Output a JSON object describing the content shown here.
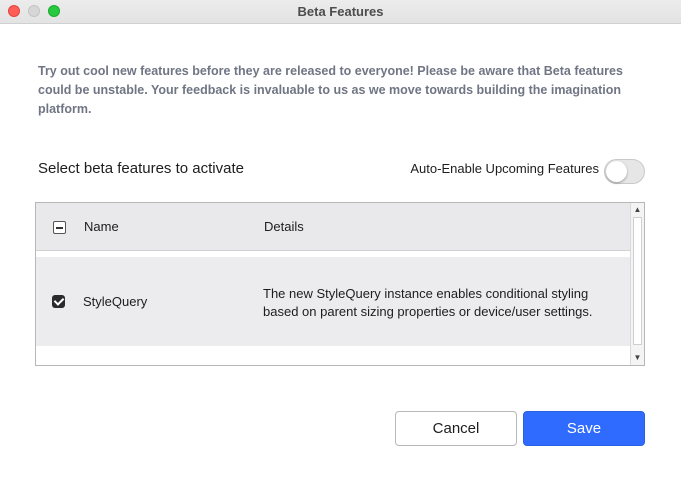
{
  "window": {
    "title": "Beta Features"
  },
  "intro": {
    "text": "Try out cool new features before they are released to everyone! Please be aware that Beta features could be unstable. Your feedback is invaluable to us as we move towards building the imagination platform."
  },
  "section": {
    "title": "Select beta features to activate",
    "auto_enable_label": "Auto-Enable Upcoming Features",
    "auto_enable_on": false
  },
  "table": {
    "columns": [
      "Name",
      "Details"
    ],
    "header_checkbox_state": "indeterminate",
    "rows": [
      {
        "checked": true,
        "name": "StyleQuery",
        "details": "The new StyleQuery instance enables conditional styling based on parent sizing properties or device/user settings."
      }
    ]
  },
  "buttons": {
    "cancel": "Cancel",
    "save": "Save"
  },
  "colors": {
    "accent": "#2f6bff",
    "intro_text": "#6f7583",
    "close": "#ff5f57",
    "maximize": "#28c840"
  }
}
